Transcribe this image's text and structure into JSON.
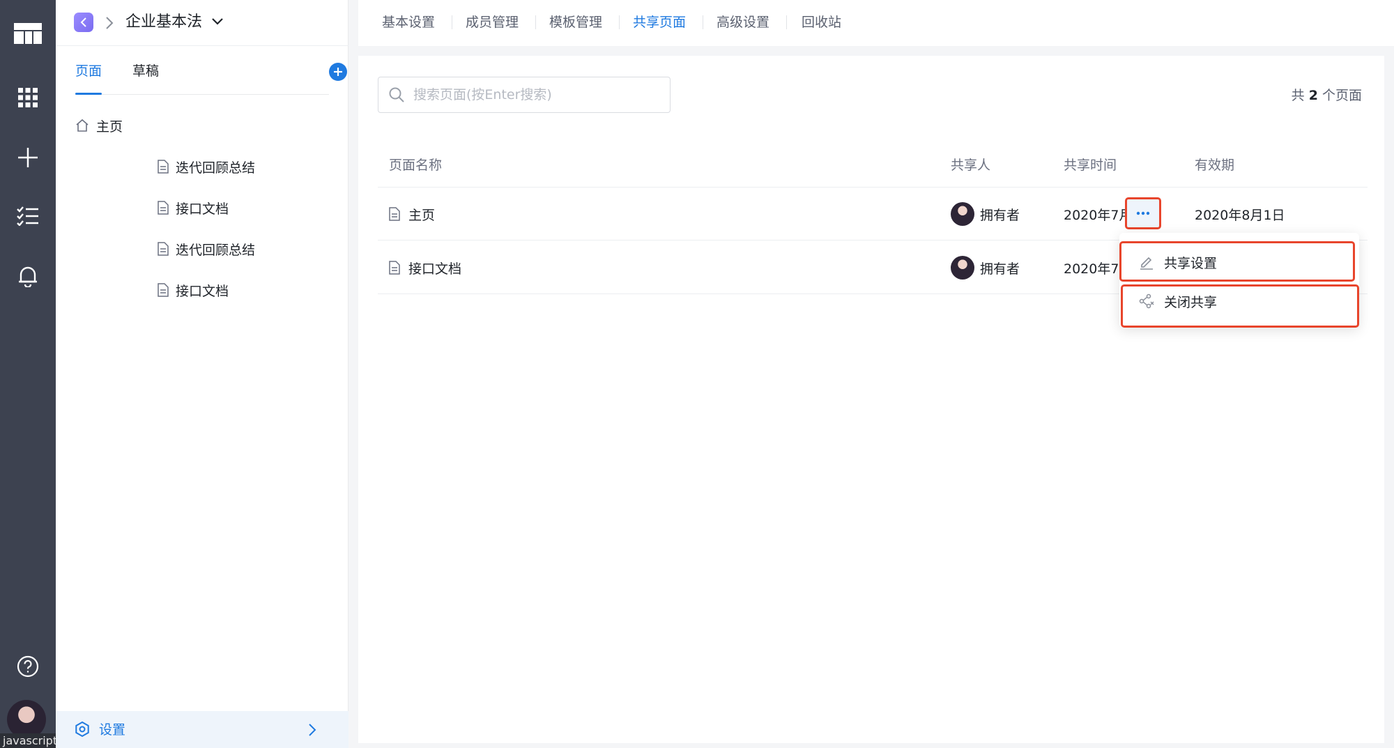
{
  "sidebar": {
    "space_title": "企业基本法",
    "tabs": [
      {
        "label": "页面"
      },
      {
        "label": "草稿"
      }
    ],
    "tree": [
      {
        "label": "主页"
      },
      {
        "label": "迭代回顾总结"
      },
      {
        "label": "接口文档"
      },
      {
        "label": "迭代回顾总结"
      },
      {
        "label": "接口文档"
      }
    ],
    "footer_label": "设置"
  },
  "top_tabs": [
    {
      "label": "基本设置"
    },
    {
      "label": "成员管理"
    },
    {
      "label": "模板管理"
    },
    {
      "label": "共享页面"
    },
    {
      "label": "高级设置"
    },
    {
      "label": "回收站"
    }
  ],
  "search": {
    "placeholder": "搜索页面(按Enter搜索)"
  },
  "count": {
    "prefix": "共",
    "number": "2",
    "suffix": "个页面"
  },
  "table": {
    "headers": [
      "页面名称",
      "共享人",
      "共享时间",
      "有效期"
    ],
    "rows": [
      {
        "name": "主页",
        "sharer": "拥有者",
        "time": "2020年7月25日",
        "expiry": "2020年8月1日"
      },
      {
        "name": "接口文档",
        "sharer": "拥有者",
        "time": "2020年7",
        "expiry": ""
      }
    ]
  },
  "menu": [
    {
      "label": "共享设置"
    },
    {
      "label": "关闭共享"
    }
  ],
  "status_tip": "javascript:;",
  "colors": {
    "accent": "#1f7ae0",
    "highlight": "#e8452c",
    "rail": "#3d4250"
  }
}
